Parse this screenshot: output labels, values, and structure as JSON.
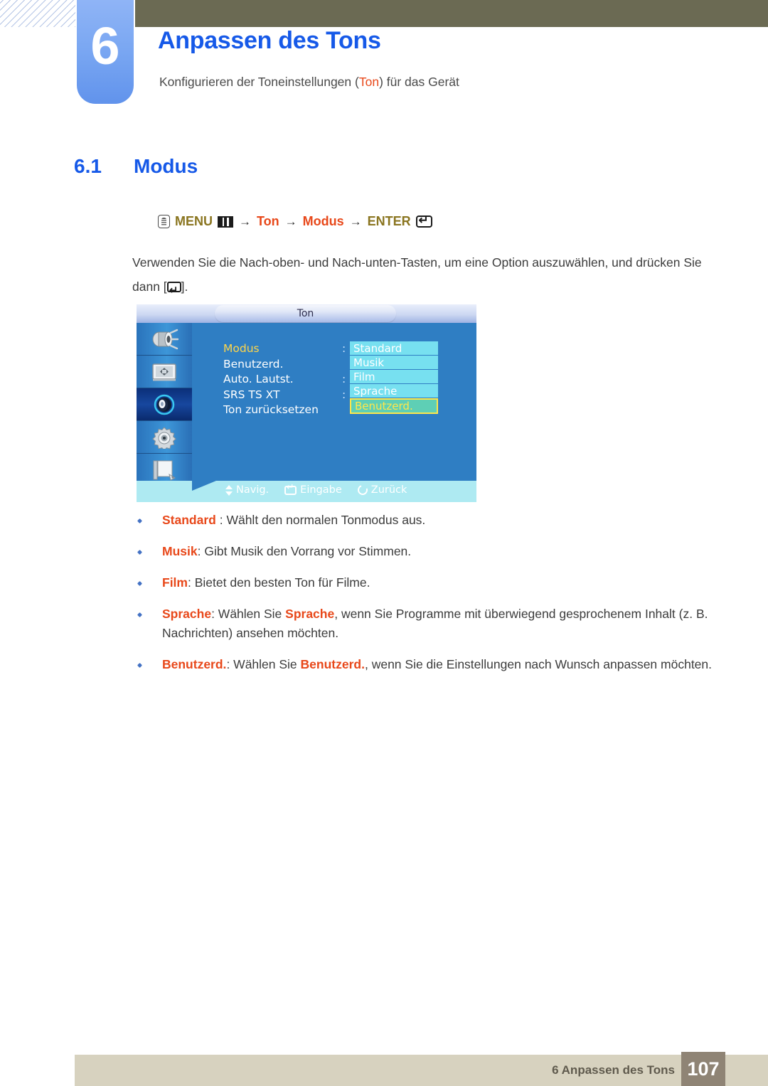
{
  "header": {
    "chapter_number": "6",
    "chapter_title": "Anpassen des Tons",
    "subtitle_pre": "Konfigurieren der Toneinstellungen (",
    "subtitle_highlight": "Ton",
    "subtitle_post": ") für das Gerät"
  },
  "section": {
    "number": "6.1",
    "name": "Modus"
  },
  "nav_path": {
    "hand_icon": "hand-press-icon",
    "menu_label": "MENU",
    "menu_icon": "menu-grid-icon",
    "arrow": "→",
    "step1": "Ton",
    "step2": "Modus",
    "enter_label": "ENTER",
    "enter_icon": "enter-key-icon"
  },
  "paragraph": {
    "text_before": "Verwenden Sie die Nach-oben- und Nach-unten-Tasten, um eine Option auszuwählen, und drücken Sie dann [",
    "text_after": "]."
  },
  "osd": {
    "title": "Ton",
    "rail_icons": [
      "picture-projector-icon",
      "screen-adjust-icon",
      "sound-speaker-icon",
      "setup-gear-icon",
      "multi-control-document-icon"
    ],
    "rail_active_index": 2,
    "menu_items": [
      {
        "label": "Modus",
        "colon": ":",
        "selected": true
      },
      {
        "label": "Benutzerd.",
        "colon": "",
        "selected": false
      },
      {
        "label": "Auto. Lautst.",
        "colon": ":",
        "selected": false
      },
      {
        "label": "SRS TS XT",
        "colon": ":",
        "selected": false
      },
      {
        "label": "Ton zurücksetzen",
        "colon": "",
        "selected": false
      }
    ],
    "options": [
      {
        "label": "Standard",
        "highlighted": false
      },
      {
        "label": "Musik",
        "highlighted": false
      },
      {
        "label": "Film",
        "highlighted": false
      },
      {
        "label": "Sprache",
        "highlighted": false
      },
      {
        "label": "Benutzerd.",
        "highlighted": true
      }
    ],
    "hints": [
      {
        "icon": "up-down-arrow-icon",
        "label": "Navig."
      },
      {
        "icon": "enter-key-icon",
        "label": "Eingabe"
      },
      {
        "icon": "return-circle-icon",
        "label": "Zurück"
      }
    ]
  },
  "bullets": [
    {
      "term": "Standard",
      "sep": " : ",
      "text": "Wählt den normalen Tonmodus aus.",
      "inline_term": "",
      "text2": ""
    },
    {
      "term": "Musik",
      "sep": ": ",
      "text": "Gibt Musik den Vorrang vor Stimmen.",
      "inline_term": "",
      "text2": ""
    },
    {
      "term": "Film",
      "sep": ": ",
      "text": "Bietet den besten Ton für Filme.",
      "inline_term": "",
      "text2": ""
    },
    {
      "term": "Sprache",
      "sep": ": ",
      "text": "Wählen Sie ",
      "inline_term": "Sprache",
      "text2": ", wenn Sie Programme mit überwiegend gesprochenem Inhalt (z. B. Nachrichten) ansehen möchten."
    },
    {
      "term": "Benutzerd.",
      "sep": ": ",
      "text": "Wählen Sie ",
      "inline_term": "Benutzerd.",
      "text2": ", wenn Sie die Einstellungen nach Wunsch anpassen möchten."
    }
  ],
  "footer": {
    "text": "6 Anpassen des Tons",
    "page_number": "107"
  },
  "colors": {
    "accent_blue": "#1659e8",
    "accent_red": "#e8481a",
    "olive": "#6b6a53",
    "footer_beige": "#d7d2bf",
    "footer_page_box": "#8f8475",
    "osd_blue": "#2f7ec3",
    "osd_option_cyan": "#77e0f0",
    "osd_highlight_teal": "#5ecfb5",
    "osd_highlight_border": "#ffe74a"
  }
}
